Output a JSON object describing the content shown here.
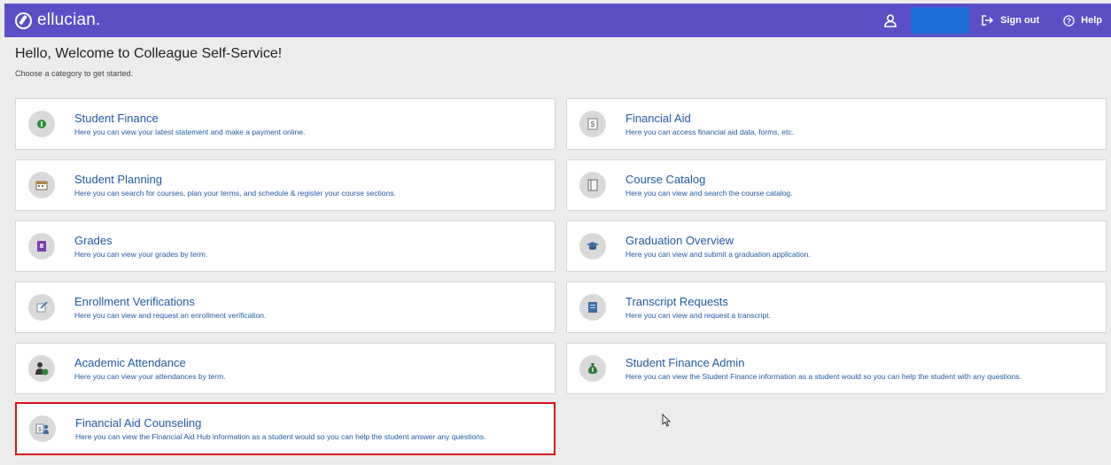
{
  "header": {
    "brand": "ellucian.",
    "signout_label": "Sign out",
    "help_label": "Help",
    "colors": {
      "bar": "#5b4fc8",
      "user_block": "#1e6fd8"
    }
  },
  "welcome": {
    "title": "Hello, Welcome to Colleague Self-Service!",
    "subtitle": "Choose a category to get started."
  },
  "tiles": [
    {
      "title": "Student Finance",
      "desc": "Here you can view your latest statement and make a payment online.",
      "icon": "money-icon"
    },
    {
      "title": "Financial Aid",
      "desc": "Here you can access financial aid data, forms, etc.",
      "icon": "financial-aid-icon"
    },
    {
      "title": "Student Planning",
      "desc": "Here you can search for courses, plan your terms, and schedule & register your course sections.",
      "icon": "calendar-icon"
    },
    {
      "title": "Course Catalog",
      "desc": "Here you can view and search the course catalog.",
      "icon": "book-icon"
    },
    {
      "title": "Grades",
      "desc": "Here you can view your grades by term.",
      "icon": "grade-book-icon"
    },
    {
      "title": "Graduation Overview",
      "desc": "Here you can view and submit a graduation application.",
      "icon": "graduation-cap-icon"
    },
    {
      "title": "Enrollment Verifications",
      "desc": "Here you can view and request an enrollment verification.",
      "icon": "verify-document-icon"
    },
    {
      "title": "Transcript Requests",
      "desc": "Here you can view and request a transcript.",
      "icon": "transcript-icon"
    },
    {
      "title": "Academic Attendance",
      "desc": "Here you can view your attendances by term.",
      "icon": "attendance-icon"
    },
    {
      "title": "Student Finance Admin",
      "desc": "Here you can view the Student Finance information as a student would so you can help the student with any questions.",
      "icon": "money-bag-icon"
    },
    {
      "title": "Financial Aid Counseling",
      "desc": "Here you can view the Financial Aid Hub information as a student would so you can help the student answer any questions.",
      "icon": "counseling-icon",
      "highlighted": true
    }
  ]
}
